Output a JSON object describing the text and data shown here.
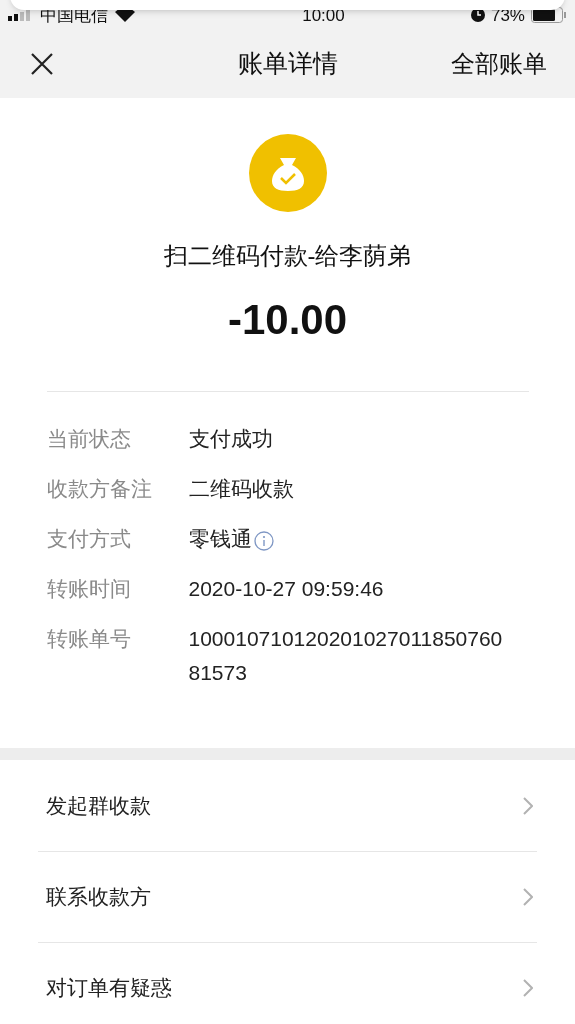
{
  "status_bar": {
    "carrier": "中国电信",
    "time": "10:00",
    "battery": "73%"
  },
  "nav": {
    "title": "账单详情",
    "action": "全部账单"
  },
  "summary": {
    "title": "扫二维码付款-给李荫弟",
    "amount": "-10.00"
  },
  "details": [
    {
      "label": "当前状态",
      "value": "支付成功",
      "info": false
    },
    {
      "label": "收款方备注",
      "value": "二维码收款",
      "info": false
    },
    {
      "label": "支付方式",
      "value": "零钱通",
      "info": true
    },
    {
      "label": "转账时间",
      "value": "2020-10-27 09:59:46",
      "info": false
    },
    {
      "label": "转账单号",
      "value": "10001071012020102701185076081573",
      "info": false
    }
  ],
  "actions": [
    {
      "label": "发起群收款"
    },
    {
      "label": "联系收款方"
    },
    {
      "label": "对订单有疑惑"
    }
  ]
}
